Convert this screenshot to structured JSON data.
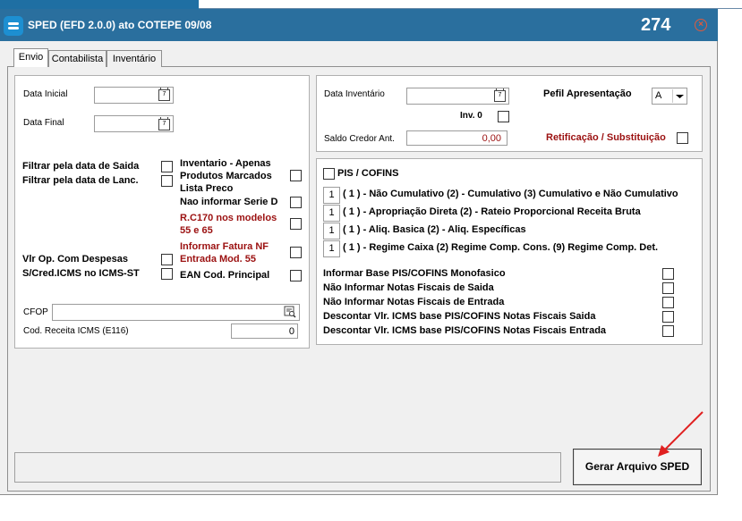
{
  "window": {
    "title": "SPED (EFD 2.0.0) ato COTEPE 09/08",
    "counter": "274",
    "close_icon": "close-circle-icon"
  },
  "tabs": [
    {
      "label": "Envio",
      "active": true
    },
    {
      "label": "Contabilista"
    },
    {
      "label": "Inventário"
    }
  ],
  "left": {
    "data_inicial_label": "Data Inicial",
    "data_final_label": "Data Final",
    "filtrar_saida_label": "Filtrar pela data de Saida",
    "filtrar_lanc_label": "Filtrar pela data de Lanc.",
    "vlr_op_label": "Vlr Op. Com Despesas",
    "scred_label": "S/Cred.ICMS no ICMS-ST",
    "inventario_label": "Inventario - Apenas Produtos Marcados Lista Preco",
    "nao_serie_label": "Nao informar Serie D",
    "rc170_label": "R.C170 nos modelos 55 e 65",
    "fatura_label": "Informar Fatura NF Entrada Mod. 55",
    "ean_label": "EAN Cod. Principal",
    "cfop_label": "CFOP",
    "cod_receita_label": "Cod. Receita ICMS (E116)",
    "cod_receita_value": "0"
  },
  "right_top": {
    "data_inventario_label": "Data Inventário",
    "perfil_label": "Pefil Apresentação",
    "perfil_value": "A",
    "inv0_label": "Inv. 0",
    "saldo_label": "Saldo Credor Ant.",
    "saldo_value": "0,00",
    "retificacao_label": "Retificação / Substituição"
  },
  "pis": {
    "header_label": "PIS / COFINS",
    "rows": [
      {
        "value": "1",
        "text": "( 1 ) - Não Cumulativo (2) - Cumulativo (3) Cumulativo e Não Cumulativo"
      },
      {
        "value": "1",
        "text": "( 1 ) - Apropriação Direta (2) - Rateio Proporcional Receita Bruta"
      },
      {
        "value": "1",
        "text": "( 1 ) - Aliq. Basica (2) - Aliq. Específicas"
      },
      {
        "value": "1",
        "text": "( 1 ) - Regime Caixa (2) Regime Comp. Cons. (9) Regime Comp. Det."
      }
    ],
    "options": [
      "Informar Base PIS/COFINS Monofasico",
      "Não Informar Notas Fiscais de Saida",
      "Não Informar Notas Fiscais de Entrada",
      "Descontar Vlr. ICMS base PIS/COFINS Notas Fiscais Saida",
      "Descontar Vlr. ICMS base PIS/COFINS Notas Fiscais Entrada"
    ]
  },
  "actions": {
    "gerar_label": "Gerar Arquivo SPED"
  },
  "colors": {
    "titlebar": "#2a6f9e",
    "accent_red": "#9b1010",
    "arrow": "#e02020"
  }
}
